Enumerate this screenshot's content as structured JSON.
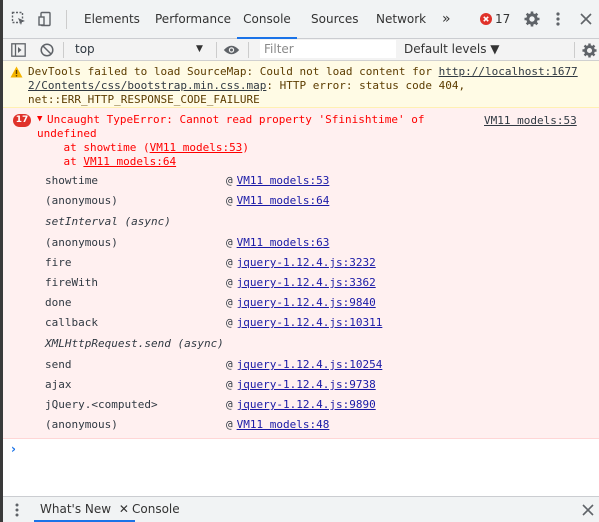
{
  "tabs": [
    {
      "label": "Elements"
    },
    {
      "label": "Performance"
    },
    {
      "label": "Console"
    },
    {
      "label": "Sources"
    },
    {
      "label": "Network"
    }
  ],
  "more_tabs": "»",
  "error_count": "17",
  "toolbar": {
    "context": "top",
    "filter_placeholder": "Filter",
    "levels": "Default levels ▼"
  },
  "warning": {
    "line1_prefix": "DevTools failed to load SourceMap: Could not load content for ",
    "line1_link": "http://localhost:1677",
    "line2_link": "2/Contents/css/bootstrap.min.css.map",
    "line2_rest": ": HTTP error: status code 404,",
    "line3": "net::ERR_HTTP_RESPONSE_CODE_FAILURE"
  },
  "error": {
    "count": "17",
    "arrow": "▼",
    "message1": "Uncaught TypeError: Cannot read property 'Sfinishtime' of",
    "message2": "undefined",
    "at1_prefix": "    at showtime (",
    "at1_link": "VM11 models:53",
    "at1_suffix": ")",
    "at2_prefix": "    at ",
    "at2_link": "VM11 models:64",
    "source_link": "VM11 models:53"
  },
  "stack": [
    {
      "fn": "showtime",
      "link": "VM11 models:53"
    },
    {
      "fn": "(anonymous)",
      "link": "VM11 models:64"
    },
    {
      "fn": "setInterval (async)",
      "async": true
    },
    {
      "fn": "(anonymous)",
      "link": "VM11 models:63"
    },
    {
      "fn": "fire",
      "link": "jquery-1.12.4.js:3232"
    },
    {
      "fn": "fireWith",
      "link": "jquery-1.12.4.js:3362"
    },
    {
      "fn": "done",
      "link": "jquery-1.12.4.js:9840"
    },
    {
      "fn": "callback",
      "link": "jquery-1.12.4.js:10311"
    },
    {
      "fn": "XMLHttpRequest.send (async)",
      "async": true
    },
    {
      "fn": "send",
      "link": "jquery-1.12.4.js:10254"
    },
    {
      "fn": "ajax",
      "link": "jquery-1.12.4.js:9738"
    },
    {
      "fn": "jQuery.<computed>",
      "link": "jquery-1.12.4.js:9890"
    },
    {
      "fn": "(anonymous)",
      "link": "VM11 models:48"
    }
  ],
  "at_sign": "@",
  "prompt": "›",
  "drawer": {
    "whats_new": "What's New",
    "console": "Console"
  },
  "colors": {
    "accent": "#1a73e8",
    "error_text": "#ff0000",
    "error_bg": "#fff0f0",
    "warning_bg": "#fffbe5"
  }
}
